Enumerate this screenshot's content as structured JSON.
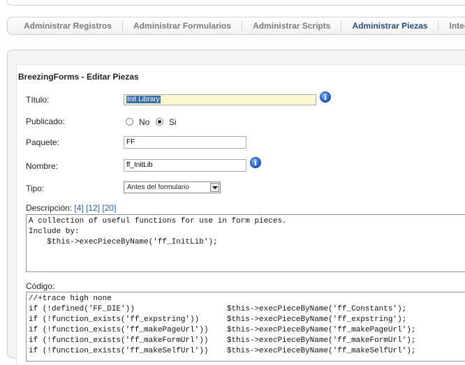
{
  "tabs": [
    {
      "label": "Administrar Registros"
    },
    {
      "label": "Administrar Formularios"
    },
    {
      "label": "Administrar Scripts"
    },
    {
      "label": "Administrar Piezas"
    },
    {
      "label": "Integ"
    }
  ],
  "active_tab": "Administrar Piezas",
  "page_title": "BreezingForms - Editar Piezas",
  "form": {
    "titulo_label": "Título:",
    "titulo_value": "Init Library",
    "publicado_label": "Publicado:",
    "publicado_no": "No",
    "publicado_si": "Si",
    "publicado_selected": "Si",
    "paquete_label": "Paquete:",
    "paquete_value": "FF",
    "nombre_label": "Nombre:",
    "nombre_value": "ff_InitLib",
    "tipo_label": "Tipo:",
    "tipo_value": "Antes del formulario",
    "descripcion_label": "Descripción:",
    "descripcion_links": [
      "[4]",
      "[12]",
      "[20]"
    ],
    "descripcion_lines": [
      "A collection of useful functions for use in form pieces.",
      "",
      "Include by:",
      "",
      "    $this->execPieceByName('ff_InitLib');"
    ],
    "codigo_label": "Código:",
    "codigo_lines": [
      "//+trace high none",
      "if (!defined('FF_DIE'))                    $this->execPieceByName('ff_Constants');",
      "if (!function_exists('ff_expstring'))      $this->execPieceByName('ff_expstring');",
      "if (!function_exists('ff_makePageUrl'))    $this->execPieceByName('ff_makePageUrl');",
      "if (!function_exists('ff_makeFormUrl'))    $this->execPieceByName('ff_makeFormUrl');",
      "if (!function_exists('ff_makeSelfUrl'))    $this->execPieceByName('ff_makeSelfUrl');"
    ]
  },
  "icons": {
    "info": "i"
  },
  "colors": {
    "active_tab": "#2a4d74",
    "inactive_tab": "#7b7b7b",
    "link": "#1f5fa8",
    "title_field_bg": "#fdf7cf"
  }
}
